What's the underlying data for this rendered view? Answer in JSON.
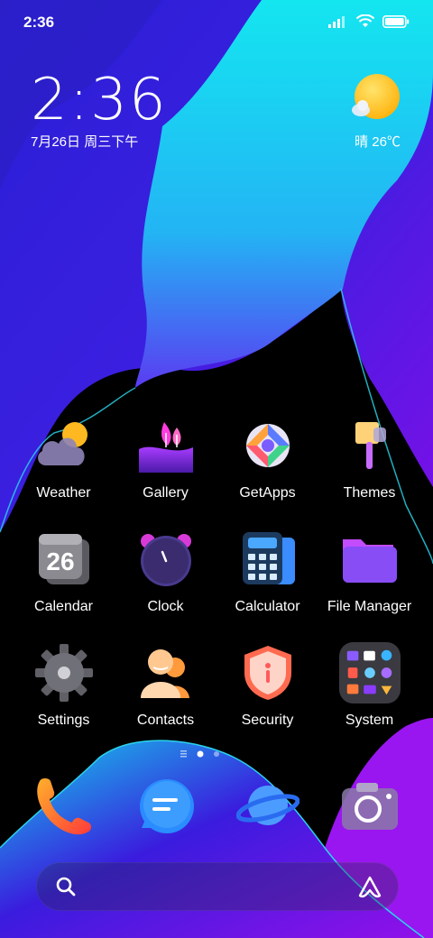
{
  "status_bar": {
    "time": "2:36",
    "icons": [
      "signal-icon",
      "wifi-icon",
      "battery-icon"
    ]
  },
  "clock_widget": {
    "time": "2:36",
    "date": "7月26日 周三下午"
  },
  "weather_widget": {
    "condition_icon": "sun-cloud-icon",
    "text": "晴 26℃"
  },
  "apps": [
    {
      "label": "Weather",
      "icon": "weather-icon"
    },
    {
      "label": "Gallery",
      "icon": "gallery-icon"
    },
    {
      "label": "GetApps",
      "icon": "getapps-icon"
    },
    {
      "label": "Themes",
      "icon": "themes-brush-icon"
    },
    {
      "label": "Calendar",
      "icon": "calendar-icon",
      "icon_text": "26"
    },
    {
      "label": "Clock",
      "icon": "clock-icon"
    },
    {
      "label": "Calculator",
      "icon": "calculator-icon"
    },
    {
      "label": "File Manager",
      "icon": "folder-icon"
    },
    {
      "label": "Settings",
      "icon": "gear-icon"
    },
    {
      "label": "Contacts",
      "icon": "contacts-icon"
    },
    {
      "label": "Security",
      "icon": "shield-icon"
    },
    {
      "label": "System",
      "icon": "folder-grid-icon"
    }
  ],
  "page_indicator": {
    "pages": 2,
    "current": 1
  },
  "dock": [
    {
      "icon": "phone-icon"
    },
    {
      "icon": "messages-icon"
    },
    {
      "icon": "browser-planet-icon"
    },
    {
      "icon": "camera-icon"
    }
  ],
  "search_bar": {
    "icons": [
      "search-icon",
      "assistant-icon"
    ]
  },
  "colors": {
    "wallpaper_blue": "#3a28e0",
    "wallpaper_cyan": "#18d8ee",
    "wallpaper_purple": "#8a12e8",
    "weather_sun": "#ffc21a"
  }
}
